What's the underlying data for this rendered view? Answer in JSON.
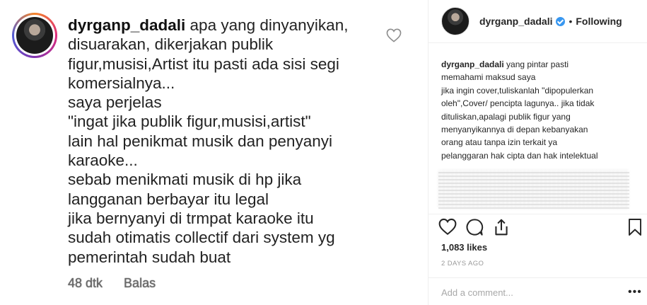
{
  "comment": {
    "username": "dyrganp_dadali",
    "lines": [
      " apa yang dinyanyikan,",
      "disuarakan,  dikerjakan publik",
      "figur,musisi,Artist itu pasti ada sisi segi",
      "komersialnya...",
      "saya perjelas",
      "\"ingat jika publik figur,musisi,artist\"",
      "lain hal penikmat musik dan penyanyi",
      "karaoke...",
      "sebab menikmati musik di hp jika",
      "langganan berbayar itu legal",
      "jika bernyanyi di trmpat karaoke itu",
      "sudah otimatis collectif dari system yg",
      "pemerintah sudah buat"
    ],
    "time": "48 dtk",
    "reply": "Balas"
  },
  "post": {
    "username": "dyrganp_dadali",
    "separator": "•",
    "follow_status": "Following",
    "caption_lines": [
      " yang pintar pasti",
      "memahami maksud saya",
      "jika ingin cover,tuliskanlah \"dipopulerkan",
      "oleh\",Cover/ pencipta lagunya.. jika tidak",
      "dituliskan,apalagi publik figur yang",
      "menyanyikannya di depan kebanyakan",
      "orang atau tanpa izin terkait ya",
      "pelanggaran hak cipta dan hak intelektual"
    ],
    "likes": "1,083 likes",
    "time_ago": "2 DAYS AGO",
    "add_comment_placeholder": "Add a comment...",
    "more_options": "•••"
  },
  "icons": {
    "comment_like": "heart-outline-icon",
    "like": "heart-icon",
    "comment": "comment-bubble-icon",
    "share": "share-icon",
    "save": "bookmark-icon",
    "verified": "verified-badge-icon"
  },
  "colors": {
    "verified": "#3897f0",
    "muted": "#999999"
  }
}
